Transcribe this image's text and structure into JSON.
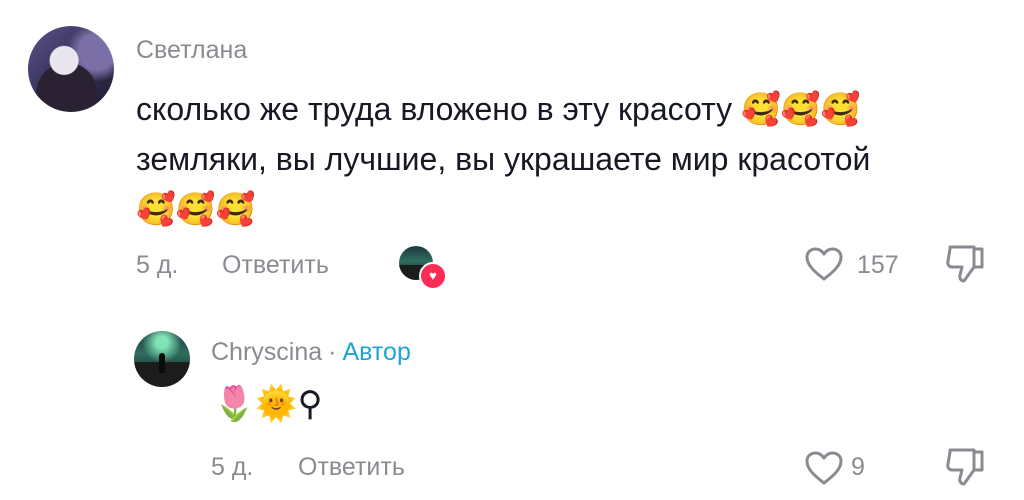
{
  "comment": {
    "username": "Светлана",
    "text_line1": "сколько же труда вложено в эту красоту",
    "emoji_line1": "🥰🥰🥰",
    "text_line2": "земляки, вы лучшие, вы украшаете мир красотой",
    "emoji_line3": "🥰🥰🥰",
    "date": "5 д.",
    "reply_label": "Ответить",
    "likes": "157"
  },
  "reply": {
    "username": "Chryscina",
    "separator": "·",
    "author_badge": "Автор",
    "text": "🌷🌞⚲",
    "date": "5 д.",
    "reply_label": "Ответить",
    "likes": "9"
  },
  "icons": {
    "like": "heart-outline-icon",
    "dislike": "thumbs-down-outline-icon",
    "creator_liked": "heart-badge-icon"
  },
  "colors": {
    "author": "#20a4d6",
    "meta": "#8a8b91",
    "heart_badge": "#fe2c55"
  }
}
